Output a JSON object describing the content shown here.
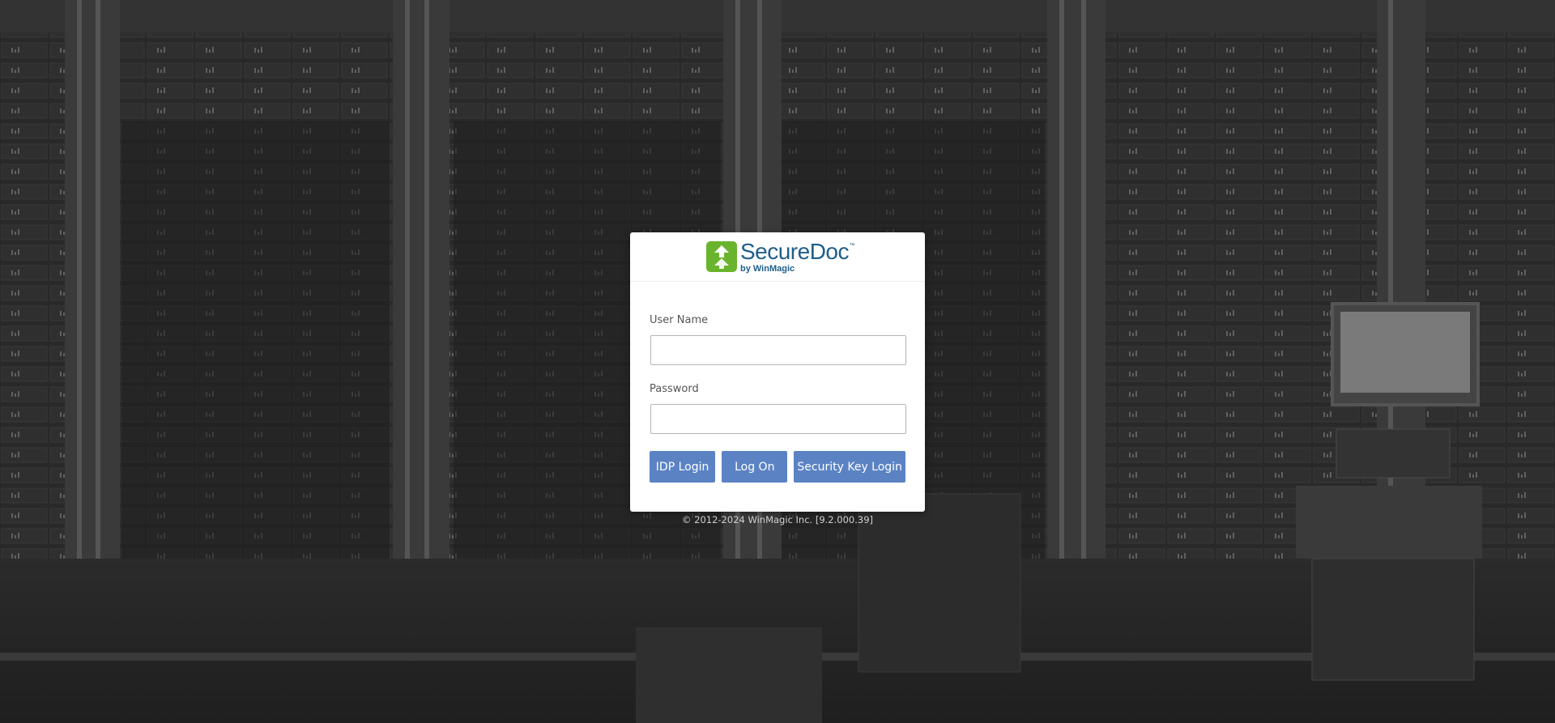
{
  "app": {
    "brand": "SecureDoc",
    "brand_tm": "™",
    "brand_sub": "by WinMagic"
  },
  "form": {
    "username_label": "User Name",
    "username_value": "",
    "password_label": "Password",
    "password_value": ""
  },
  "buttons": {
    "idp_login": "IDP Login",
    "log_on": "Log On",
    "security_key_login": "Security Key Login"
  },
  "footer": {
    "copyright": "© 2012-2024 WinMagic Inc. [9.2.000.39]"
  },
  "colors": {
    "button": "#5b83c4",
    "brand_blue": "#1d5f8a",
    "brand_green": "#6ab42d",
    "background": "#262626"
  },
  "icons": {
    "logo": "securedoc-logo-icon"
  }
}
